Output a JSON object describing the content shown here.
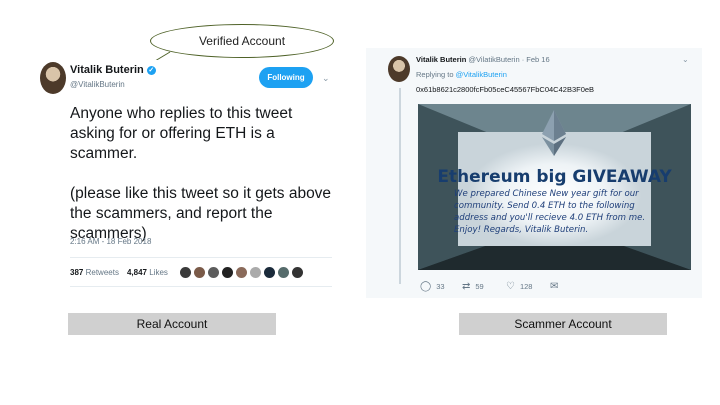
{
  "callout": {
    "text": "Verified Account"
  },
  "real_tweet": {
    "name": "Vitalik Buterin",
    "handle": "@VitalikButerin",
    "follow_label": "Following",
    "text_line1": "Anyone who replies to this tweet asking for or offering ETH is a scammer.",
    "text_line2": "(please like this tweet so it gets above the scammers, and report the scammers)",
    "timestamp": "2:16 AM - 18 Feb 2018",
    "retweets_count": "387",
    "retweets_label": "Retweets",
    "likes_count": "4,847",
    "likes_label": "Likes"
  },
  "labels": {
    "real": "Real Account",
    "scammer": "Scammer Account"
  },
  "scam_tweet": {
    "name": "Vitalik Buterin",
    "handle_date": "@VilatikButerin · Feb 16",
    "replying_prefix": "Replying to",
    "replying_handle": "@VitalikButerin",
    "address": "0x61b8621c2800fcFb05ceC45567FbC04C42B3F0eB",
    "banner_title": "Ethereum big GIVEAWAY",
    "banner_lines": [
      "We prepared Chinese New year gift for our",
      "community. Send 0.4 ETH to the following",
      "address and you'll recieve 4.0 ETH from me.",
      "Enjoy! Regards, Vitalik Buterin."
    ],
    "replies": "33",
    "retweets": "59",
    "likes": "128"
  },
  "colors": {
    "twitter_blue": "#1da1f2",
    "callout_border": "#4f6228",
    "label_bg": "#d0d0d0"
  }
}
